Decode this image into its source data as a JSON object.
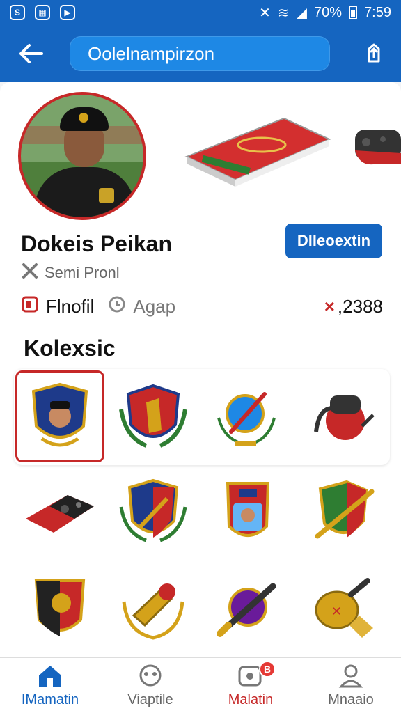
{
  "status_bar": {
    "icons_left": [
      "notification-icon",
      "gallery-icon",
      "video-icon"
    ],
    "battery": "70%",
    "time": "7:59"
  },
  "app_bar": {
    "search_text": "Oolelnampirzon"
  },
  "profile": {
    "name": "Dokeis Peikan",
    "role": "Semi Pronl",
    "connect_label": "Dlleoextin",
    "tag1": "Flnofil",
    "tag2": "Agap",
    "amount": ",2388",
    "amount_prefix": "×"
  },
  "collection": {
    "title": "Kolexsic"
  },
  "nav": {
    "items": [
      {
        "label": "IMamatin"
      },
      {
        "label": "Viaptile"
      },
      {
        "label": "Malatin",
        "badge": "B"
      },
      {
        "label": "Mnaaio"
      }
    ]
  },
  "colors": {
    "primary": "#1565c0",
    "accent_red": "#c62828"
  }
}
